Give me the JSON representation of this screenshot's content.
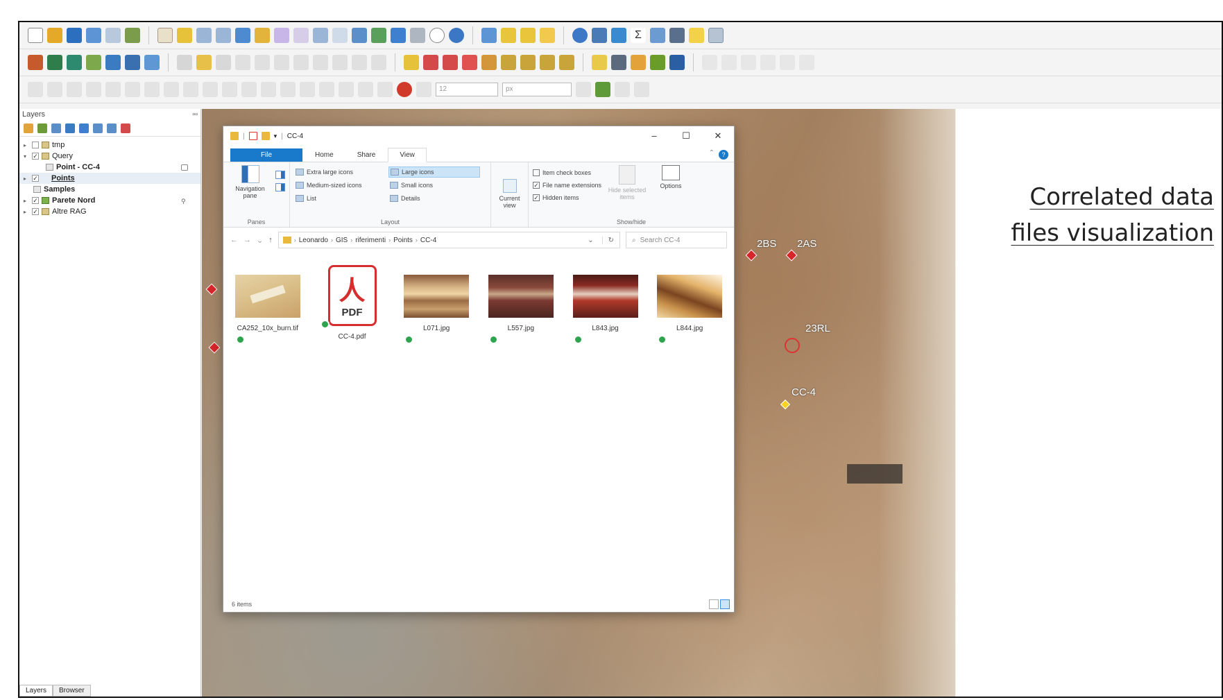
{
  "caption": {
    "line1": "Correlated data",
    "line2": "files visualization"
  },
  "layers_panel": {
    "title": "Layers",
    "tabs": [
      "Layers",
      "Browser"
    ],
    "items": [
      {
        "label": "tmp",
        "checked": false,
        "level": 0
      },
      {
        "label": "Query",
        "checked": true,
        "level": 0
      },
      {
        "label": "Point - CC-4",
        "checked": false,
        "level": 1
      },
      {
        "label": "Points",
        "checked": true,
        "level": 0
      },
      {
        "label": "Samples",
        "checked": false,
        "level": 0
      },
      {
        "label": "Parete Nord",
        "checked": true,
        "level": 0
      },
      {
        "label": "Altre RAG",
        "checked": true,
        "level": 0
      }
    ]
  },
  "map": {
    "labels": [
      "2BS",
      "2AS",
      "23RL",
      "CC-4"
    ],
    "marker_color": "#d7262b",
    "selected_color": "#ffd21f"
  },
  "explorer": {
    "title": "CC-4",
    "tabs": [
      "File",
      "Home",
      "Share",
      "View"
    ],
    "ribbon": {
      "panes": {
        "label": "Panes",
        "navigation_pane": "Navigation pane"
      },
      "layout": {
        "label": "Layout",
        "options": [
          "Extra large icons",
          "Large icons",
          "Medium-sized icons",
          "Small icons",
          "List",
          "Details"
        ],
        "selected": "Large icons"
      },
      "current_view": "Current view",
      "show_hide": {
        "label": "Show/hide",
        "item_check_boxes": "Item check boxes",
        "file_name_extensions": "File name extensions",
        "hidden_items": "Hidden items",
        "hide_selected": "Hide selected items",
        "options": "Options"
      }
    },
    "address": [
      "Leonardo",
      "GIS",
      "riferimenti",
      "Points",
      "CC-4"
    ],
    "search_placeholder": "Search CC-4",
    "files": [
      {
        "name": "CA252_10x_burn.tif",
        "kind": "image"
      },
      {
        "name": "CC-4.pdf",
        "kind": "pdf"
      },
      {
        "name": "L071.jpg",
        "kind": "image"
      },
      {
        "name": "L557.jpg",
        "kind": "image"
      },
      {
        "name": "L843.jpg",
        "kind": "image"
      },
      {
        "name": "L844.jpg",
        "kind": "image"
      }
    ],
    "pdf_badge": "PDF",
    "status": "6 items"
  },
  "toolbar_combos": {
    "size": "12",
    "unit": "px"
  }
}
